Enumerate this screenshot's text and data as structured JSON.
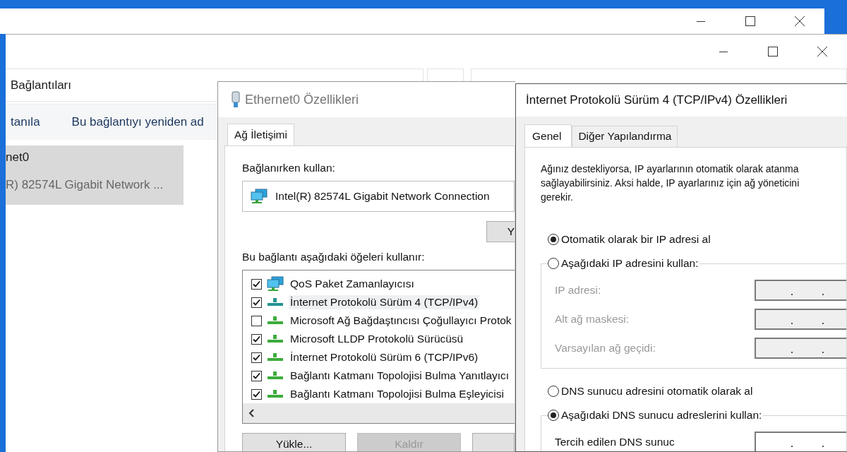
{
  "explorer": {
    "breadcrumb": "Bağlantıları",
    "commands": [
      "tanıla",
      "Bu bağlantıyı yeniden ad"
    ],
    "connection": {
      "name": "net0",
      "adapter": "R) 82574L Gigabit Network ...",
      "selected": true
    }
  },
  "ethernet_dialog": {
    "title": "Ethernet0 Özellikleri",
    "tabs": [
      {
        "label": "Ağ İletişimi",
        "selected": true
      }
    ],
    "connect_using_label": "Bağlanırken kullan:",
    "adapter": "Intel(R) 82574L Gigabit Network Connection",
    "configure_button": "Y",
    "items_label": "Bu bağlantı aşağıdaki öğeleri kullanır:",
    "items": [
      {
        "label": "QoS Paket Zamanlayıcısı",
        "kind": "service",
        "checked": true,
        "selected": false
      },
      {
        "label": "İnternet Protokolü Sürüm 4 (TCP/IPv4)",
        "kind": "protocol",
        "checked": true,
        "selected": true
      },
      {
        "label": "Microsoft Ağ Bağdaştıncısı Çoğullayıcı Protok",
        "kind": "protocol",
        "checked": false,
        "selected": false
      },
      {
        "label": "Microsoft LLDP Protokolü Sürücüsü",
        "kind": "protocol",
        "checked": true,
        "selected": false
      },
      {
        "label": "İnternet Protokolü Sürüm 6 (TCP/IPv6)",
        "kind": "protocol",
        "checked": true,
        "selected": false
      },
      {
        "label": "Bağlantı Katmanı Topolojisi Bulma Yanıtlayıcı",
        "kind": "protocol",
        "checked": true,
        "selected": false
      },
      {
        "label": "Bağlantı Katmanı Topolojisi Bulma Eşleyicisi",
        "kind": "protocol",
        "checked": true,
        "selected": false
      }
    ],
    "buttons": [
      {
        "label": "Yükle...",
        "disabled": false
      },
      {
        "label": "Kaldır",
        "disabled": true
      },
      {
        "disabled": false
      }
    ]
  },
  "ipv4_dialog": {
    "title": "İnternet Protokolü Sürüm 4 (TCP/IPv4) Özellikleri",
    "tabs": [
      {
        "label": "Genel",
        "selected": true
      },
      {
        "label": "Diğer Yapılandırma",
        "selected": false
      }
    ],
    "description": "Ağınız destekliyorsa, IP ayarlarının otomatik olarak atanma\nsağlayabilirsiniz. Aksi halde, IP ayarlarınız için ağ yöneticini\ngerekir.",
    "ip_mode": [
      {
        "label": "Otomatik olarak bir IP adresi al",
        "selected": true
      },
      {
        "label": "Aşağıdaki IP adresini kullan:",
        "selected": false
      }
    ],
    "ip_fields": [
      {
        "label": "IP adresi:",
        "disabled": true
      },
      {
        "label": "Alt ağ maskesi:",
        "disabled": true
      },
      {
        "label": "Varsayılan ağ geçidi:",
        "disabled": true
      }
    ],
    "dns_mode": [
      {
        "label": "DNS sunucu adresini otomatik olarak al",
        "selected": false
      },
      {
        "label": "Aşağıdaki DNS sunucu adreslerini kullan:",
        "selected": true
      }
    ],
    "dns_fields": [
      {
        "label": "Tercih edilen DNS sunuc",
        "disabled": false
      }
    ]
  }
}
